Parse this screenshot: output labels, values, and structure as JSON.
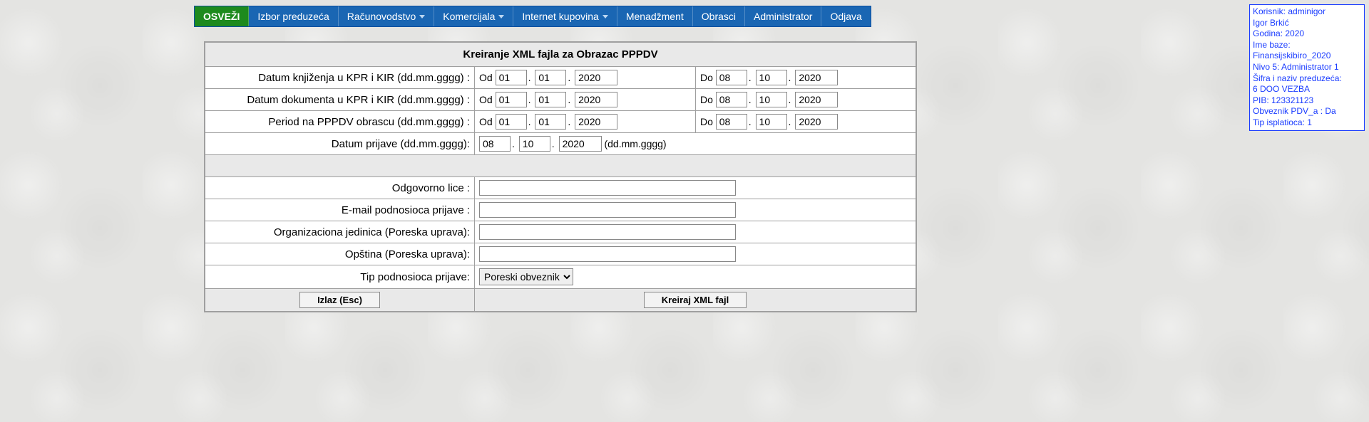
{
  "nav": {
    "refresh": "OSVEŽI",
    "items": [
      "Izbor preduzeća",
      "Računovodstvo",
      "Komercijala",
      "Internet kupovina",
      "Menadžment",
      "Obrasci",
      "Administrator",
      "Odjava"
    ],
    "has_dropdown": [
      false,
      true,
      true,
      true,
      false,
      false,
      false,
      false
    ]
  },
  "info": {
    "korisnik": "Korisnik: adminigor",
    "ime": "Igor Brkić",
    "godina": "Godina: 2020",
    "baza_label": "Ime baze:",
    "baza_value": "Finansijskibiro_2020",
    "nivo": "Nivo 5: Administrator 1",
    "sifra_label": "Šifra i naziv preduzeća:",
    "sifra_value": "6 DOO VEZBA",
    "pib": "PIB: 123321123",
    "obveznik": "Obveznik PDV_a : Da",
    "tip": "Tip isplatioca: 1"
  },
  "form": {
    "title": "Kreiranje XML fajla za Obrazac PPPDV",
    "labels": {
      "r1": "Datum knjiženja u KPR i KIR (dd.mm.gggg) :",
      "r2": "Datum dokumenta u KPR i KIR (dd.mm.gggg) :",
      "r3": "Period na PPPDV obrascu (dd.mm.gggg) :",
      "r4": "Datum prijave (dd.mm.gggg):",
      "r5": "Odgovorno lice :",
      "r6": "E-mail podnosioca prijave :",
      "r7": "Organizaciona jedinica (Poreska uprava):",
      "r8": "Opština (Poreska uprava):",
      "r9": "Tip podnosioca prijave:",
      "od": "Od",
      "do": "Do",
      "hint": "(dd.mm.gggg)"
    },
    "values": {
      "r1_od_d": "01",
      "r1_od_m": "01",
      "r1_od_y": "2020",
      "r1_do_d": "08",
      "r1_do_m": "10",
      "r1_do_y": "2020",
      "r2_od_d": "01",
      "r2_od_m": "01",
      "r2_od_y": "2020",
      "r2_do_d": "08",
      "r2_do_m": "10",
      "r2_do_y": "2020",
      "r3_od_d": "01",
      "r3_od_m": "01",
      "r3_od_y": "2020",
      "r3_do_d": "08",
      "r3_do_m": "10",
      "r3_do_y": "2020",
      "r4_d": "08",
      "r4_m": "10",
      "r4_y": "2020",
      "r5": "",
      "r6": "",
      "r7": "",
      "r8": "",
      "r9_selected": "Poreski obveznik"
    },
    "buttons": {
      "exit": "Izlaz (Esc)",
      "create": "Kreiraj XML fajl"
    }
  }
}
